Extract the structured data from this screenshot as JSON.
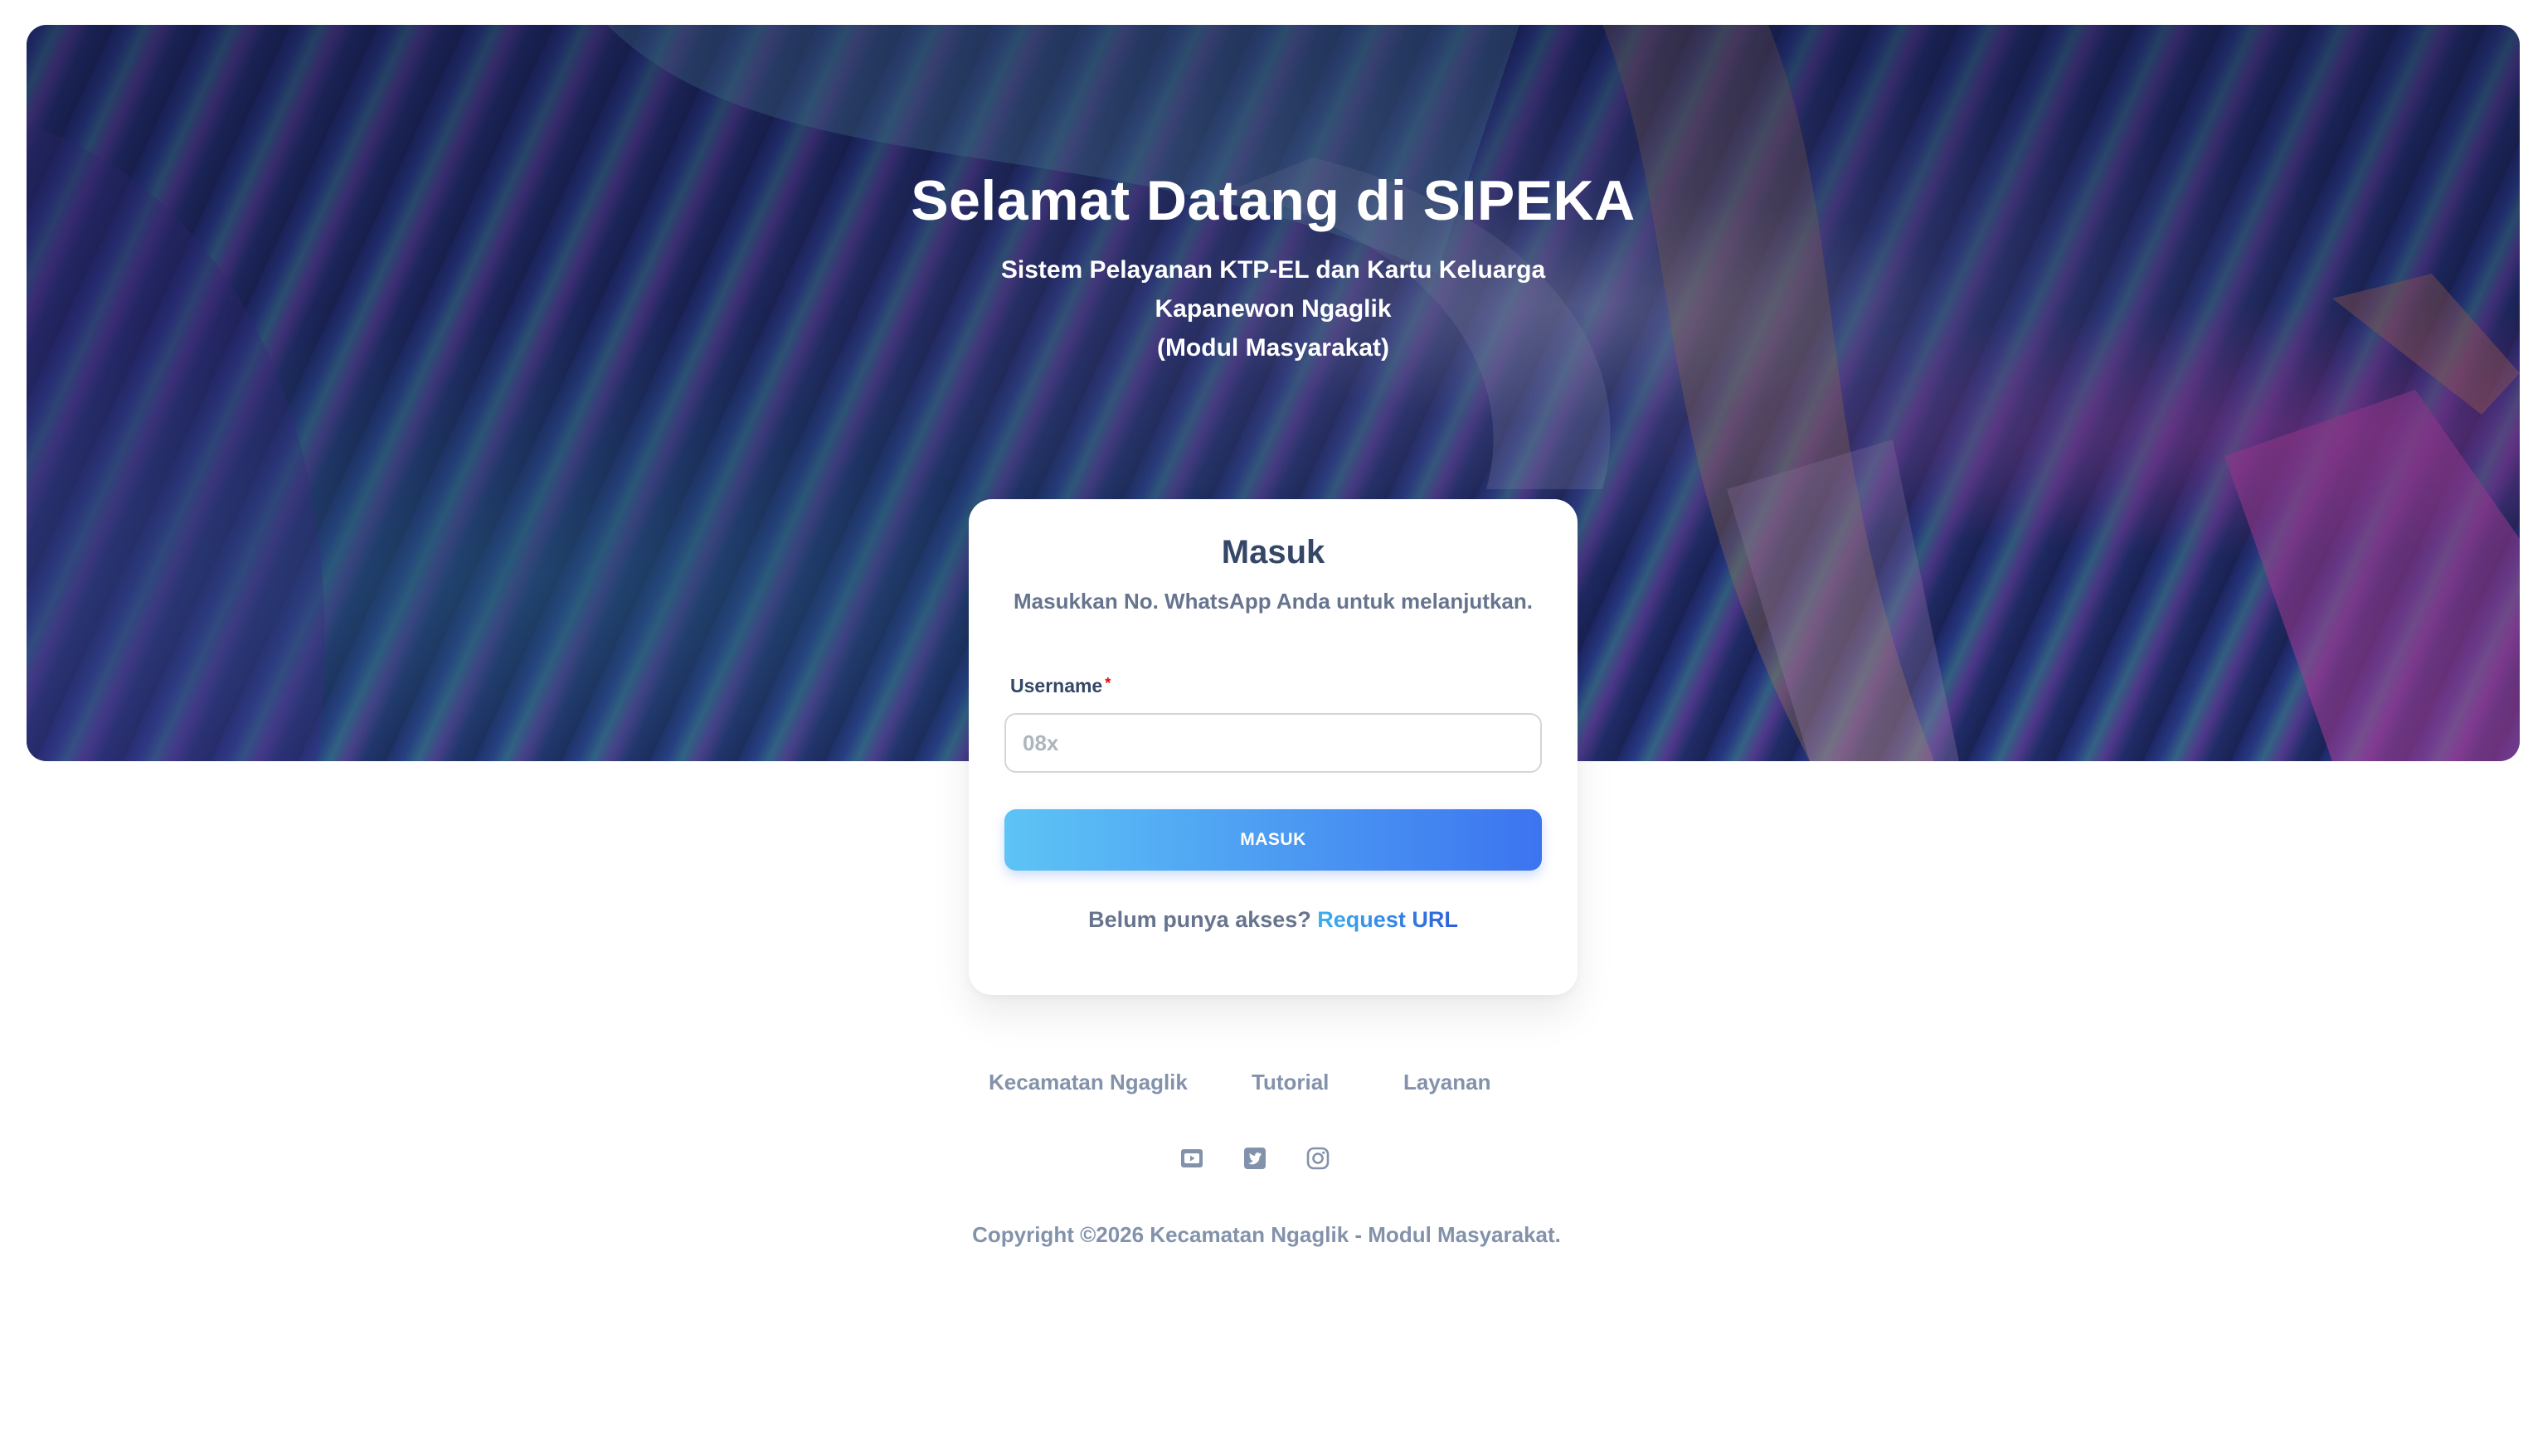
{
  "hero": {
    "title": "Selamat Datang di SIPEKA",
    "subtitle_line1": "Sistem Pelayanan KTP-EL dan Kartu Keluarga",
    "subtitle_line2": "Kapanewon Ngaglik",
    "subtitle_line3": "(Modul Masyarakat)"
  },
  "login": {
    "title": "Masuk",
    "description": "Masukkan No. WhatsApp Anda untuk melanjutkan.",
    "username_label": "Username",
    "required_mark": "*",
    "username_value": "",
    "username_placeholder": "08x",
    "submit_label": "MASUK",
    "access_text": "Belum punya akses?",
    "request_link": "Request URL"
  },
  "footer": {
    "links": [
      "Kecamatan Ngaglik",
      "Tutorial",
      "Layanan"
    ],
    "social_icons": [
      "youtube-icon",
      "twitter-icon",
      "instagram-icon"
    ],
    "copyright": "Copyright ©2026 Kecamatan Ngaglik - Modul Masyarakat."
  },
  "colors": {
    "primary_gradient_start": "#5dc4f5",
    "primary_gradient_end": "#3c74f0",
    "heading": "#344767",
    "muted": "#67748e",
    "footer_text": "#8392ab",
    "required": "#ea0606"
  }
}
